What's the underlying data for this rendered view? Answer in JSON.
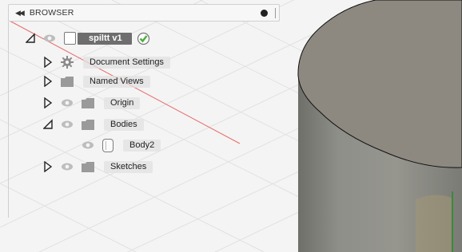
{
  "browser": {
    "collapse_icon": "double-chevron-left-icon",
    "title": "BROWSER",
    "pin_icon": "pin-dot-icon"
  },
  "tree": {
    "root": {
      "label": "spiltt v1",
      "expanded": true,
      "icon": "document-icon",
      "status_icon": "check-icon"
    },
    "items": [
      {
        "label": "Document Settings",
        "expanded": false,
        "icon": "gear-icon"
      },
      {
        "label": "Named Views",
        "expanded": false,
        "icon": "folder-icon"
      },
      {
        "label": "Origin",
        "expanded": false,
        "icon": "folder-icon",
        "visible": true
      },
      {
        "label": "Bodies",
        "expanded": true,
        "icon": "folder-icon",
        "visible": true,
        "children": [
          {
            "label": "Body2",
            "icon": "body-icon",
            "visible": true
          }
        ]
      },
      {
        "label": "Sketches",
        "expanded": false,
        "icon": "folder-icon",
        "visible": true
      }
    ]
  },
  "colors": {
    "background": "#f4f4f4",
    "grid": "#e0e0e0",
    "axis_red": "#e05050",
    "body_side": "#8a8a84",
    "body_top": "#8c8880",
    "root_highlight": "#6e6e6e",
    "check_green": "#4cae3c"
  }
}
